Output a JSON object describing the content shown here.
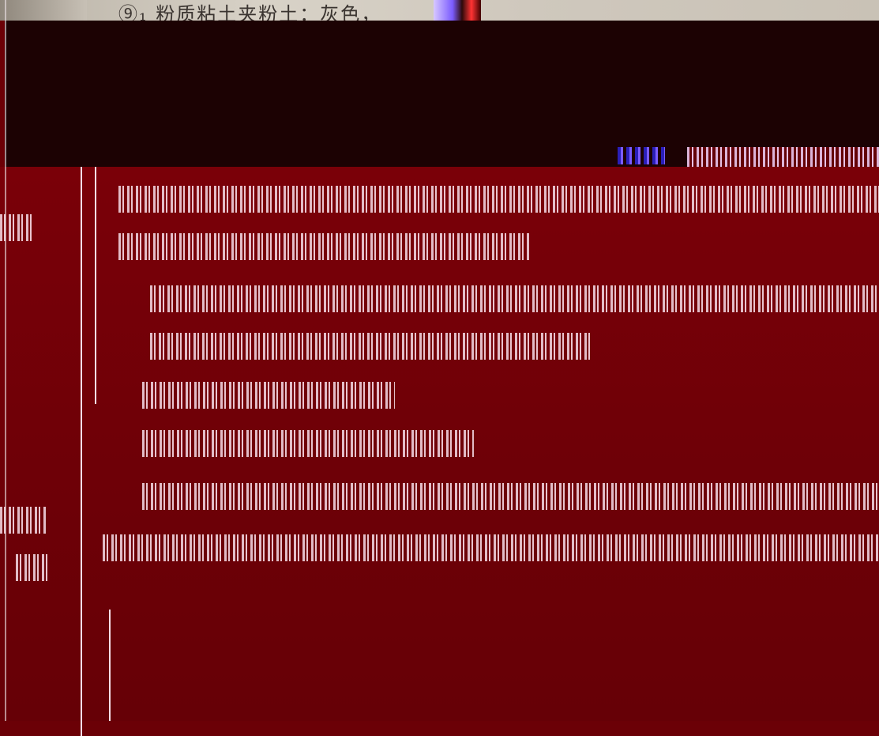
{
  "document": {
    "header_line": "⑨₁ 粉质粘土夹粉土：灰色，"
  }
}
